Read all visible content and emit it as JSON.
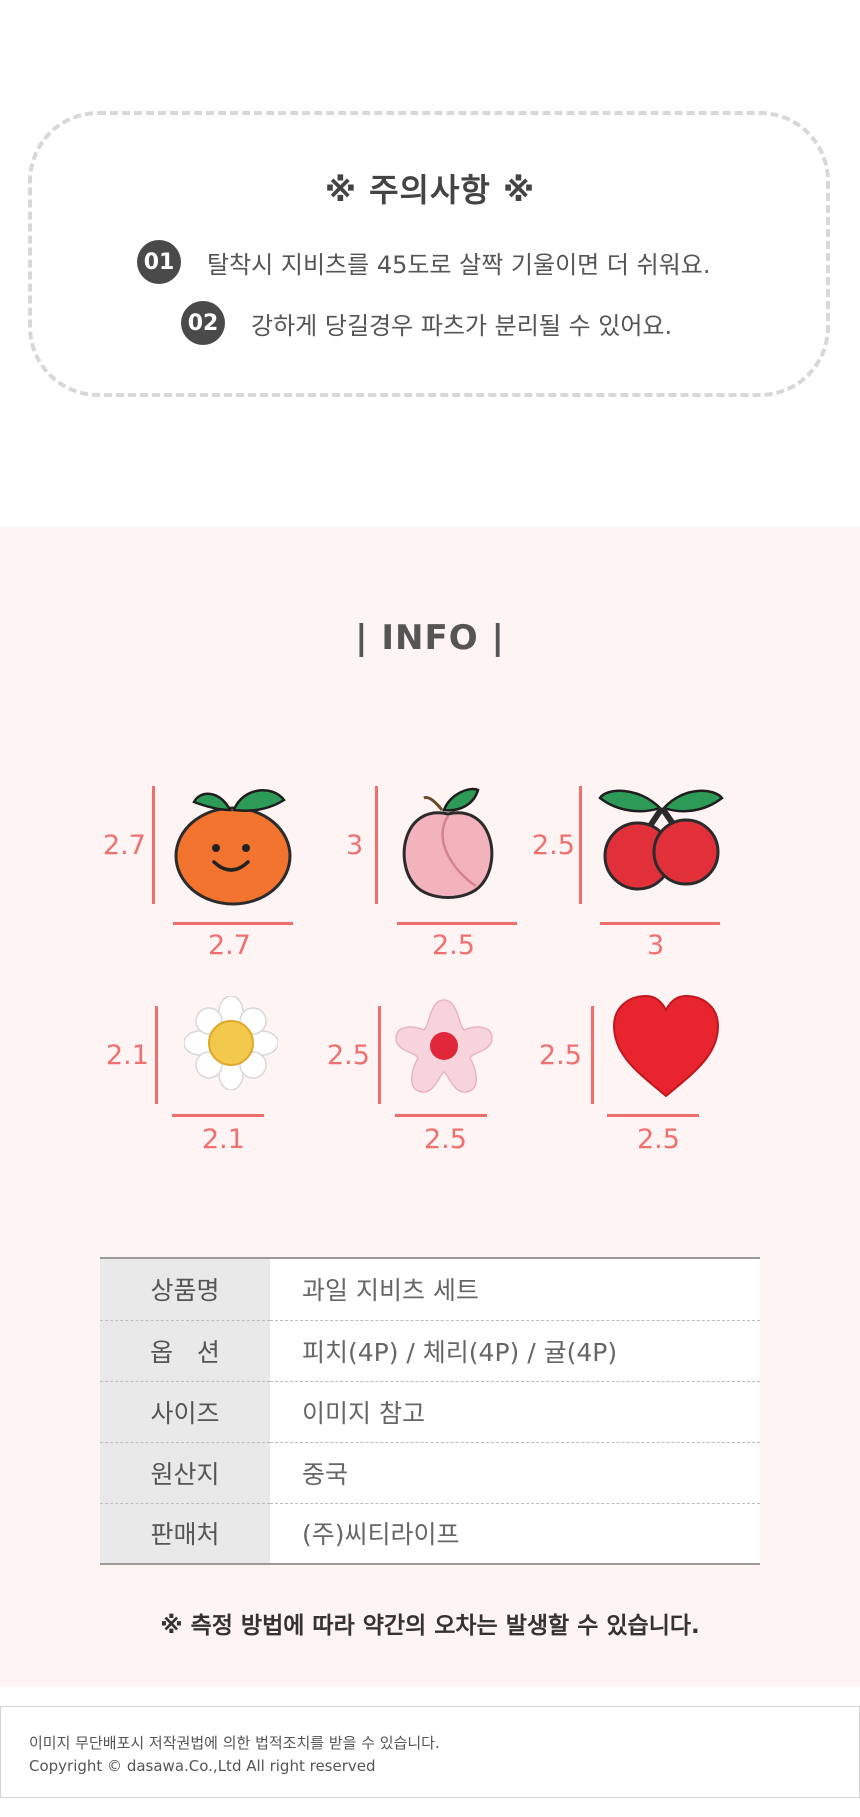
{
  "caution": {
    "title": "※ 주의사항 ※",
    "items": [
      {
        "num": "01",
        "text": "탈착시 지비츠를 45도로 살짝 기울이면 더 쉬워요."
      },
      {
        "num": "02",
        "text": "강하게 당길경우 파츠가 분리될 수 있어요."
      }
    ]
  },
  "info": {
    "title": "| INFO |",
    "sizes": [
      {
        "name": "orange",
        "height": "2.7",
        "width": "2.7"
      },
      {
        "name": "peach",
        "height": "3",
        "width": "2.5"
      },
      {
        "name": "cherry",
        "height": "2.5",
        "width": "3"
      },
      {
        "name": "daisy",
        "height": "2.1",
        "width": "2.1"
      },
      {
        "name": "pink-flower",
        "height": "2.5",
        "width": "2.5"
      },
      {
        "name": "heart",
        "height": "2.5",
        "width": "2.5"
      }
    ]
  },
  "spec": {
    "rows": [
      {
        "key": "상품명",
        "value": "과일 지비츠 세트"
      },
      {
        "key": "옵   션",
        "value": "피치(4P) / 체리(4P) / 귤(4P)"
      },
      {
        "key": "사이즈",
        "value": "이미지 참고"
      },
      {
        "key": "원산지",
        "value": "중국"
      },
      {
        "key": "판매처",
        "value": "(주)씨티라이프"
      }
    ],
    "note": "※ 측정 방법에 따라 약간의 오차는 발생할 수 있습니다."
  },
  "footer": {
    "line1": "이미지 무단배포시 저작권법에 의한 법적조치를 받을 수 있습니다.",
    "line2": "Copyright © dasawa.Co.,Ltd All right reserved"
  },
  "colors": {
    "accent": "#ef6f6f",
    "infoBg": "#fff4f4",
    "badge": "#4a4a4a"
  }
}
